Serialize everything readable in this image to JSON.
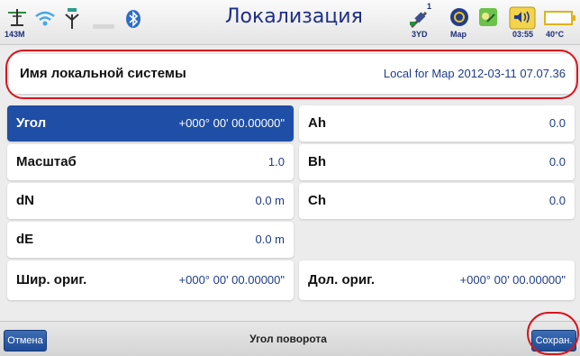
{
  "status": {
    "gps_label": "143M",
    "satellite_label": "3YD",
    "map_label": "Map",
    "clock": "03:55",
    "temperature": "40°C",
    "sat_count": "1"
  },
  "title": "Локализация",
  "local_system": {
    "label": "Имя локальной системы",
    "value": "Local for Map 2012-03-11 07.07.36"
  },
  "left_fields": [
    {
      "label": "Угол",
      "value": "+000° 00' 00.00000\""
    },
    {
      "label": "Масштаб",
      "value": "1.0"
    },
    {
      "label": "dN",
      "value": "0.0 m"
    },
    {
      "label": "dE",
      "value": "0.0 m"
    },
    {
      "label": "Шир. ориг.",
      "value": "+000° 00' 00.00000\""
    }
  ],
  "right_fields": [
    {
      "label": "Ah",
      "value": "0.0"
    },
    {
      "label": "Bh",
      "value": "0.0"
    },
    {
      "label": "Ch",
      "value": "0.0"
    },
    {
      "label": "Дол. ориг.",
      "value": "+000° 00' 00.00000\""
    }
  ],
  "bottom": {
    "cancel_label": "Отмена",
    "hint": "Угол поворота",
    "save_label": "Сохран."
  },
  "colors": {
    "accent": "#1f4ea6",
    "title": "#1f2f86",
    "highlight_ring": "#d9141d"
  }
}
